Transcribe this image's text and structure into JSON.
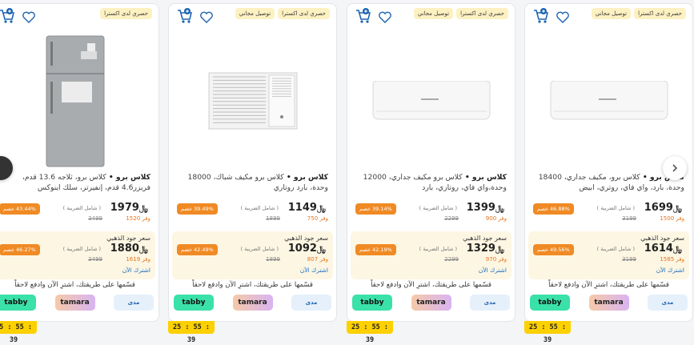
{
  "currency": "﷼",
  "timer": "25 : 55 : 39",
  "installments_text": "قسّمها على طريقتك، اشترِ الآن وادفع لاحقاً",
  "gold_label": "سعر جود الذهبي",
  "subscribe_label": "اشترك الآن",
  "vat_label": "( شامل الضريبة )",
  "pay_methods": [
    "tabby",
    "tamara",
    "مدى"
  ],
  "products": [
    {
      "badges": [
        "حصري لدى اكسترا",
        "توصيل مجاني"
      ],
      "brand": "كلاس برو •",
      "title": "كلاس برو، مكيف جداري، 18400 وحدة، بارد، واي فاي، روتري، ابيض",
      "price": "1699",
      "old_price": "3199",
      "save": "وفر 1500",
      "discount": "46.88% خصم",
      "gold_price": "1614",
      "gold_old": "3199",
      "gold_save": "وفر 1585",
      "gold_discount": "49.56% خصم",
      "image": "split-ac"
    },
    {
      "badges": [
        "حصري لدى اكسترا",
        "توصيل مجاني"
      ],
      "brand": "كلاس برو •",
      "title": "كلاس برو مكيف جداري، 12000 وحدة،واي فاي، روتاري، بارد",
      "price": "1399",
      "old_price": "2299",
      "save": "وفر 900",
      "discount": "39.14% خصم",
      "gold_price": "1329",
      "gold_old": "2299",
      "gold_save": "وفر 970",
      "gold_discount": "42.19% خصم",
      "image": "split-ac"
    },
    {
      "badges": [
        "حصري لدى اكسترا",
        "توصيل مجاني"
      ],
      "brand": "كلاس برو •",
      "title": "كلاس برو مكيف شباك، 18000 وحدة، بارد روتاري",
      "price": "1149",
      "old_price": "1899",
      "save": "وفر 750",
      "discount": "39.49% خصم",
      "gold_price": "1092",
      "gold_old": "1899",
      "gold_save": "وفر 807",
      "gold_discount": "42.49% خصم",
      "image": "window-ac"
    },
    {
      "badges": [
        "حصري لدى اكسترا"
      ],
      "brand": "كلاس برو •",
      "title": "كلاس برو، ثلاجه 13.6 قدم، فريزر4.6 قدم، إنفيرتر، سلك اينوكس",
      "price": "1979",
      "old_price": "3499",
      "save": "وفر 1520",
      "discount": "43.44% خصم",
      "gold_price": "1880",
      "gold_old": "3499",
      "gold_save": "وفر 1619",
      "gold_discount": "46.27% خصم",
      "image": "fridge"
    }
  ]
}
